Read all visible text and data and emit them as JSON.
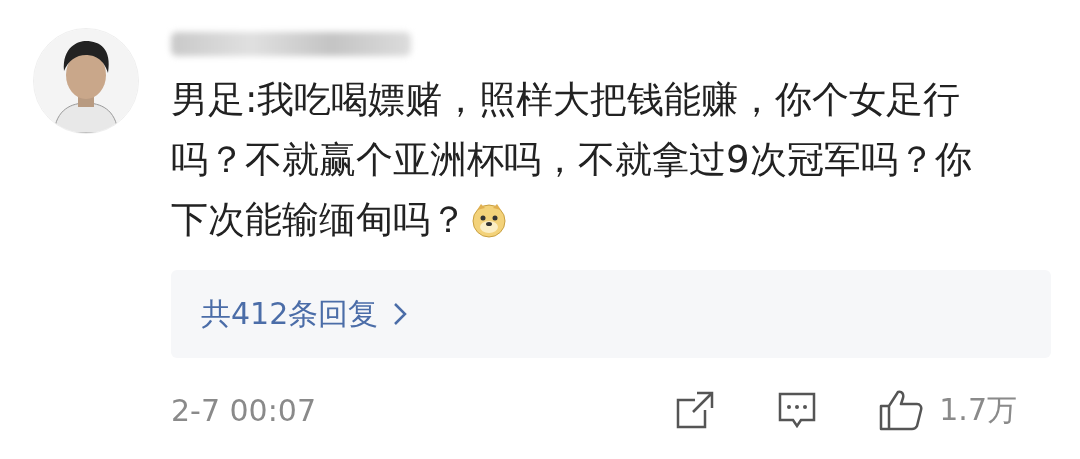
{
  "comment": {
    "text": "男足:我吃喝嫖赌，照样大把钱能赚，你个女足行吗？不就赢个亚洲杯吗，不就拿过9次冠军吗？你下次能输缅甸吗？"
  },
  "replies": {
    "label": "共412条回复"
  },
  "footer": {
    "time": "2-7 00:07",
    "likes": "1.7万"
  }
}
